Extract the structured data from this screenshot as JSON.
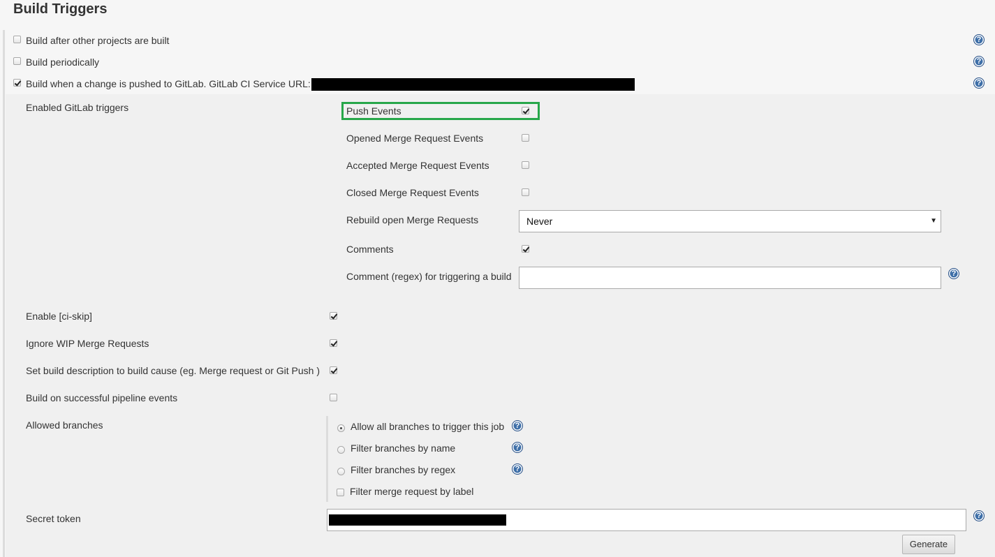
{
  "section": {
    "title": "Build Triggers"
  },
  "triggers": [
    {
      "label": "Build after other projects are built",
      "checked": false
    },
    {
      "label": "Build periodically",
      "checked": false
    },
    {
      "label": "Build when a change is pushed to GitLab. GitLab CI Service URL:",
      "checked": true
    }
  ],
  "gitlab": {
    "enabled_triggers_label": "Enabled GitLab triggers",
    "events": [
      {
        "label": "Push Events",
        "checked": true
      },
      {
        "label": "Opened Merge Request Events",
        "checked": false
      },
      {
        "label": "Accepted Merge Request Events",
        "checked": false
      },
      {
        "label": "Closed Merge Request Events",
        "checked": false
      }
    ],
    "rebuild": {
      "label": "Rebuild open Merge Requests",
      "value": "Never"
    },
    "comments": {
      "label": "Comments",
      "checked": true
    },
    "comment_regex": {
      "label": "Comment (regex) for triggering a build",
      "value": ""
    }
  },
  "options": [
    {
      "label": "Enable [ci-skip]",
      "checked": true
    },
    {
      "label": "Ignore WIP Merge Requests",
      "checked": true
    },
    {
      "label": "Set build description to build cause (eg. Merge request or Git Push )",
      "checked": true
    },
    {
      "label": "Build on successful pipeline events",
      "checked": false
    }
  ],
  "branches": {
    "label": "Allowed branches",
    "radios": [
      {
        "label": "Allow all branches to trigger this job",
        "selected": true
      },
      {
        "label": "Filter branches by name",
        "selected": false
      },
      {
        "label": "Filter branches by regex",
        "selected": false
      }
    ],
    "label_filter": {
      "label": "Filter merge request by label",
      "checked": false
    }
  },
  "secret": {
    "label": "Secret token",
    "generate_label": "Generate"
  },
  "icons": {
    "help": "question-mark-help-icon",
    "help_glyph": "?"
  },
  "colors": {
    "highlight": "#27a74a",
    "help": "#3e6fa8"
  }
}
